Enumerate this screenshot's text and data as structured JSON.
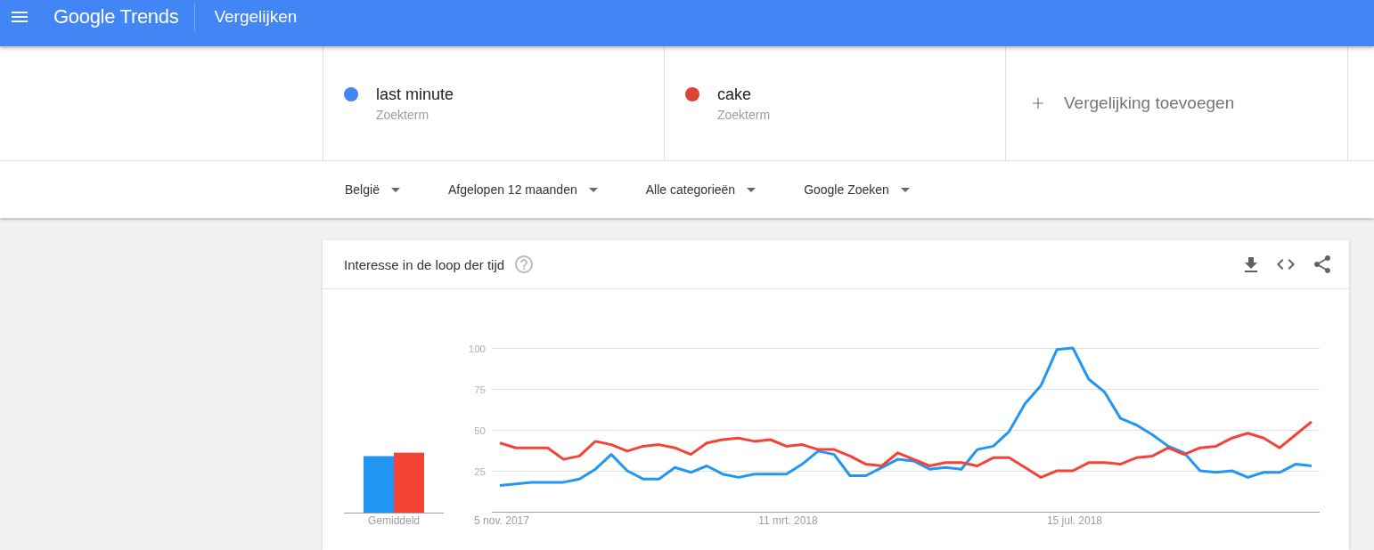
{
  "header": {
    "logo": "Google Trends",
    "title": "Vergelijken"
  },
  "terms": [
    {
      "term": "last minute",
      "type_label": "Zoekterm",
      "color": "#4285f4"
    },
    {
      "term": "cake",
      "type_label": "Zoekterm",
      "color": "#db4437"
    }
  ],
  "add_comparison": {
    "label": "Vergelijking toevoegen"
  },
  "filters": [
    {
      "label": "België"
    },
    {
      "label": "Afgelopen 12 maanden"
    },
    {
      "label": "Alle categorieën"
    },
    {
      "label": "Google Zoeken"
    }
  ],
  "card": {
    "title": "Interesse in de loop der tijd",
    "average_chart": {
      "label": "Gemiddeld"
    },
    "chart_data": {
      "type": "line",
      "categories": [
        "5 nov. 2017",
        null,
        null,
        null,
        null,
        null,
        null,
        null,
        null,
        null,
        null,
        null,
        null,
        null,
        null,
        null,
        null,
        null,
        "11 mrt. 2018",
        null,
        null,
        null,
        null,
        null,
        null,
        null,
        null,
        null,
        null,
        null,
        null,
        null,
        null,
        null,
        null,
        null,
        "15 jul. 2018",
        null,
        null,
        null,
        null,
        null,
        null,
        null,
        null,
        null,
        null,
        null,
        null,
        null,
        null,
        null
      ],
      "ylim": [
        0,
        100
      ],
      "yticks": [
        25,
        50,
        75,
        100
      ],
      "grid": true,
      "series": [
        {
          "color": "#2196f3",
          "values": [
            16,
            17,
            18,
            18,
            18,
            20,
            26,
            35,
            25,
            20,
            20,
            27,
            24,
            28,
            23,
            21,
            23,
            23,
            23,
            29,
            37,
            35,
            22,
            22,
            27,
            32,
            31,
            26,
            27,
            26,
            38,
            40,
            49,
            66,
            77,
            99,
            100,
            81,
            73,
            57,
            53,
            47,
            40,
            36,
            25,
            24,
            25,
            21,
            24,
            24,
            29,
            28
          ]
        },
        {
          "color": "#f44336",
          "values": [
            42,
            39,
            39,
            39,
            32,
            34,
            43,
            41,
            37,
            40,
            41,
            39,
            35,
            42,
            44,
            45,
            43,
            44,
            40,
            41,
            38,
            38,
            34,
            29,
            28,
            36,
            32,
            28,
            30,
            30,
            28,
            33,
            33,
            27,
            21,
            25,
            25,
            30,
            30,
            29,
            33,
            34,
            39,
            35,
            39,
            40,
            45,
            48,
            45,
            39,
            47,
            55
          ]
        }
      ]
    }
  }
}
